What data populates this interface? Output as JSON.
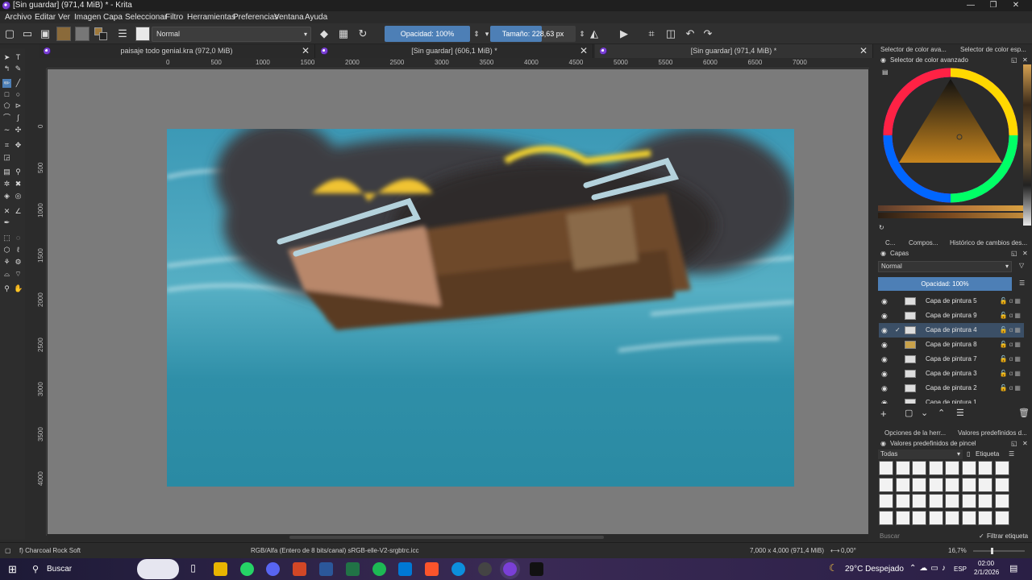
{
  "window": {
    "title": "[Sin guardar]  (971,4 MiB) * - Krita",
    "minimize": "—",
    "restore": "❐",
    "close": "✕"
  },
  "menu": [
    "Archivo",
    "Editar",
    "Ver",
    "Imagen",
    "Capa",
    "Seleccionar",
    "Filtro",
    "Herramientas",
    "Preferencias",
    "Ventana",
    "Ayuda"
  ],
  "toolbar": {
    "blend_mode": "Normal",
    "opacity": "Opacidad: 100%",
    "size": "Tamaño: 228,63 px"
  },
  "tabs": [
    {
      "label": "paisaje todo genial.kra (972,0 MiB)",
      "close": "✕"
    },
    {
      "label": "[Sin guardar]  (606,1 MiB) *",
      "close": "✕"
    },
    {
      "label": "[Sin guardar]  (971,4 MiB) *",
      "close": "✕"
    }
  ],
  "ruler_h": [
    "0",
    "500",
    "1000",
    "1500",
    "2000",
    "2500",
    "3000",
    "3500",
    "4000",
    "4500",
    "5000",
    "5500",
    "6000",
    "6500",
    "7000"
  ],
  "ruler_v": [
    "0",
    "500",
    "1000",
    "1500",
    "2000",
    "2500",
    "3000",
    "3500",
    "4000"
  ],
  "right_panel": {
    "top_tabs": [
      "Selector de color ava...",
      "Selector de color esp..."
    ],
    "color_selector_title": "Selector de color avanzado",
    "mid_tabs": [
      "C...",
      "Compos...",
      "Histórico de cambios des..."
    ],
    "layers_title": "Capas",
    "layers_blend": "Normal",
    "layers_opacity": "Opacidad:  100%",
    "layers": [
      "Capa de pintura 5",
      "Capa de pintura 9",
      "Capa de pintura 4",
      "Capa de pintura 8",
      "Capa de pintura 7",
      "Capa de pintura 3",
      "Capa de pintura 2",
      "Capa de pintura 1"
    ],
    "bottom_tabs": [
      "Opciones de la herr...",
      "Valores predefinidos d..."
    ],
    "presets_title": "Valores predefinidos de pincel",
    "presets_filter": "Todas",
    "presets_tag": "Etiqueta",
    "search_placeholder": "Buscar",
    "filter_tag": "Filtrar etiqueta",
    "filter_check": "✓"
  },
  "status": {
    "brush": "f) Charcoal Rock Soft",
    "color_model": "RGB/Alfa (Entero de 8 bits/canal)  sRGB-elle-V2-srgbtrc.icc",
    "dimensions": "7,000 x 4,000 (971,4 MiB)",
    "rotation": "0,00°",
    "zoom": "16,7%"
  },
  "taskbar": {
    "search": "Buscar",
    "weather": "29°C  Despejado",
    "language": "ESP",
    "time": "02:00",
    "date": "2/1/2026"
  },
  "colors": {
    "accent": "#4d7fb6",
    "bg": "#2b2b2b",
    "canvas_bg": "#7b7b7b"
  }
}
